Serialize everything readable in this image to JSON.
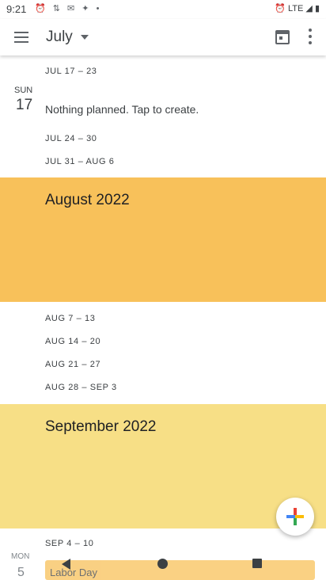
{
  "status_bar": {
    "time": "9:21",
    "left_icons": [
      "alarm-icon",
      "mobile-data-icon",
      "gmail-icon",
      "cast-icon",
      "dot-icon"
    ],
    "right_text": "LTE",
    "right_icons": [
      "alarm-icon",
      "signal-icon",
      "battery-icon"
    ]
  },
  "app_bar": {
    "month": "July",
    "icons": [
      "menu-icon",
      "chevron-down-icon",
      "calendar-today-icon",
      "more-vert-icon"
    ]
  },
  "schedule": {
    "week_jul_17": "JUL 17 – 23",
    "day_name": "SUN",
    "day_number": "17",
    "empty_day_text": "Nothing planned. Tap to create.",
    "week_jul_24": "JUL 24 – 30",
    "week_jul_31": "JUL 31 – AUG 6",
    "august_banner": "August 2022",
    "week_aug_7": "AUG 7 – 13",
    "week_aug_14": "AUG 14 – 20",
    "week_aug_21": "AUG 21 – 27",
    "week_aug_28": "AUG 28 – SEP 3",
    "september_banner": "September 2022",
    "week_sep_4": "SEP 4 – 10",
    "bottom_day_name": "MON",
    "bottom_day_number": "5",
    "bottom_event": "Labor Day"
  },
  "colors": {
    "august_banner": "#f8c15a",
    "september_banner": "#f7df86"
  }
}
